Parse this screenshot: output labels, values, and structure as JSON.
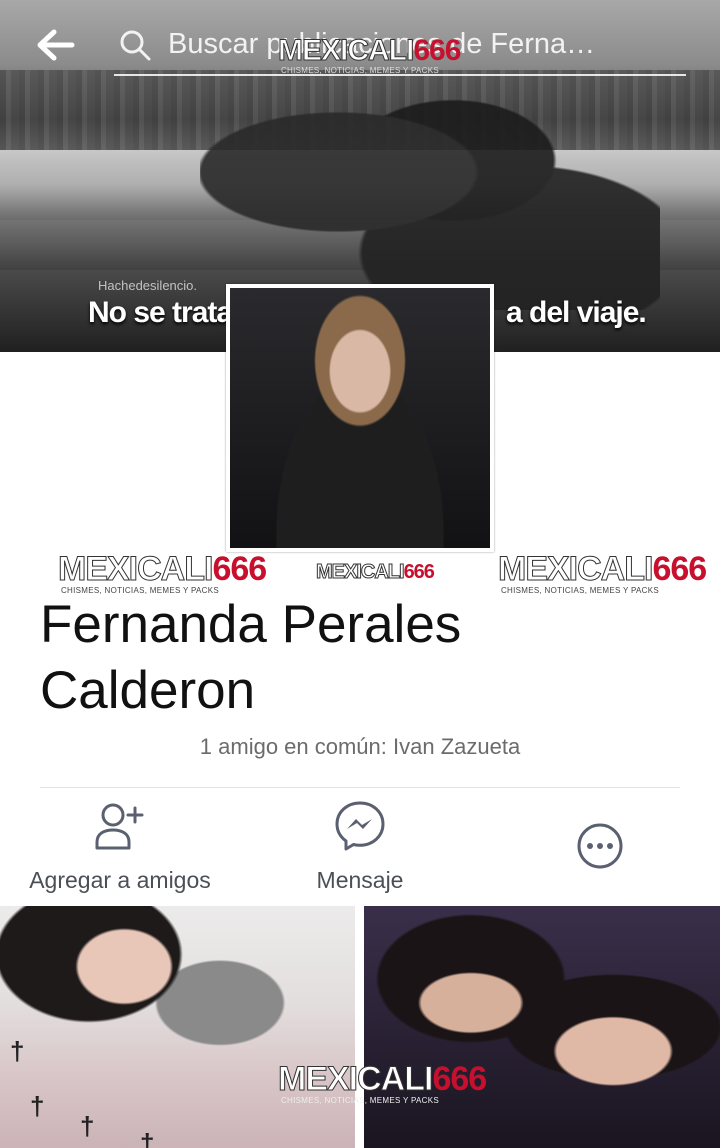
{
  "header": {
    "back_icon": "arrow-left-icon",
    "search_icon": "search-icon",
    "search_text": "Buscar publicaciones de Ferna…"
  },
  "cover": {
    "small_text": "Hachedesilencio.",
    "caption_left": "No se trata",
    "caption_right": "a del viaje."
  },
  "watermark": {
    "part1": "MEXICALI",
    "part2": "666",
    "sub": "CHISMES, NOTICIAS, MEMES Y PACKS"
  },
  "profile": {
    "name_line1": "Fernanda Perales",
    "name_line2": "Calderon",
    "mutual": "1 amigo en común: Ivan Zazueta"
  },
  "actions": {
    "add_friend_label": "Agregar a amigos",
    "message_label": "Mensaje",
    "add_friend_icon": "add-friend-icon",
    "message_icon": "messenger-icon",
    "more_icon": "more-options-icon"
  },
  "colors": {
    "accent_red": "#c8102e",
    "icon_gray": "#5a6070",
    "text_dark": "#111111",
    "text_muted": "#6b6b6b"
  }
}
